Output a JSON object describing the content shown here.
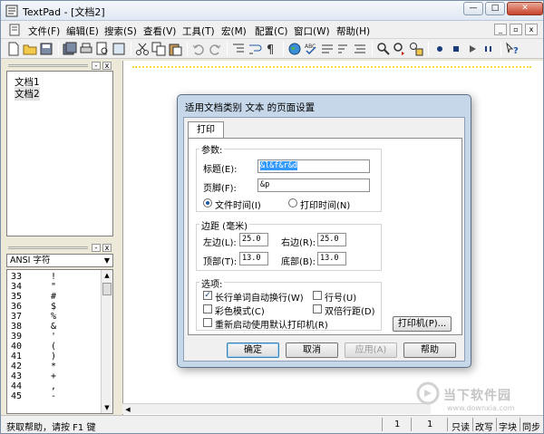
{
  "app": {
    "title": "TextPad - [文档2]"
  },
  "title_buttons": {
    "minimize": "—",
    "maximize": "□",
    "close": "✕"
  },
  "menu": {
    "items": [
      "文件(F)",
      "编辑(E)",
      "搜索(S)",
      "查看(V)",
      "工具(T)",
      "宏(M)",
      "配置(C)",
      "窗口(W)",
      "帮助(H)"
    ],
    "mdi_min": "_",
    "mdi_restore": "▫",
    "mdi_close": "x"
  },
  "document_selector": {
    "items": [
      "文档1",
      "文档2"
    ],
    "selected": "文档2",
    "close": "x"
  },
  "clip_library": {
    "selected": "ANSI 字符",
    "rows": [
      {
        "code": "33",
        "char": "!"
      },
      {
        "code": "34",
        "char": "\""
      },
      {
        "code": "35",
        "char": "#"
      },
      {
        "code": "36",
        "char": "$"
      },
      {
        "code": "37",
        "char": "%"
      },
      {
        "code": "38",
        "char": "&"
      },
      {
        "code": "39",
        "char": "'"
      },
      {
        "code": "40",
        "char": "("
      },
      {
        "code": "41",
        "char": ")"
      },
      {
        "code": "42",
        "char": "*"
      },
      {
        "code": "43",
        "char": "+"
      },
      {
        "code": "44",
        "char": ","
      },
      {
        "code": "45",
        "char": "-"
      }
    ]
  },
  "status": {
    "help": "获取帮助，请按 F1 键",
    "line": "1",
    "col": "1",
    "read_only": "只读",
    "overwrite": "改写",
    "block": "字块",
    "sync": "同步"
  },
  "watermark": {
    "text": "当下软件园",
    "url": "www.downxia.com"
  },
  "dialog": {
    "title": "适用文档类别 文本 的页面设置",
    "tab": "打印",
    "params": {
      "group_label": "参数:",
      "header_label": "标题(E):",
      "header_value": "&l&f&r&d",
      "footer_label": "页脚(F):",
      "footer_value": "&p",
      "radio_file_time": "文件时间(I)",
      "radio_print_time": "打印时间(N)",
      "selected_radio": "file_time"
    },
    "margins": {
      "group_label": "边距 (毫米)",
      "left_label": "左边(L):",
      "left_value": "25.0",
      "right_label": "右边(R):",
      "right_value": "25.0",
      "top_label": "顶部(T):",
      "top_value": "13.0",
      "bottom_label": "底部(B):",
      "bottom_value": "13.0"
    },
    "options": {
      "group_label": "选项:",
      "wrap_label": "长行单词自动换行(W)",
      "wrap_checked": true,
      "line_numbers_label": "行号(U)",
      "color_label": "彩色模式(C)",
      "double_spacing_label": "双倍行距(D)",
      "reset_printer_label": "重新启动使用默认打印机(R)",
      "printer_button": "打印机(P)..."
    },
    "buttons": {
      "ok": "确定",
      "cancel": "取消",
      "apply": "应用(A)",
      "help": "帮助"
    }
  }
}
